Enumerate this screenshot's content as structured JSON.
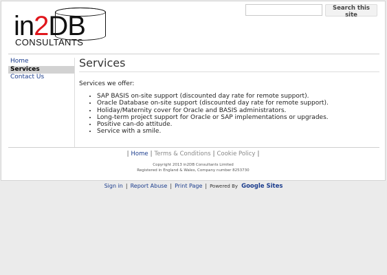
{
  "header": {
    "logo": {
      "main_prefix": "in",
      "main_accent": "2",
      "main_suffix": "DB",
      "sub": "CONSULTANTS"
    },
    "search": {
      "placeholder": "",
      "button_label": "Search this site"
    }
  },
  "sidebar": {
    "items": [
      {
        "label": "Home",
        "active": false
      },
      {
        "label": "Services",
        "active": true
      },
      {
        "label": "Contact Us",
        "active": false
      }
    ]
  },
  "main": {
    "title": "Services",
    "intro": "Services we offer:",
    "services": [
      "SAP BASIS on-site support (discounted day rate for remote support).",
      "Oracle Database on-site support (discounted day rate for remote support).",
      "Holiday/Maternity cover for Oracle and BASIS administrators.",
      "Long-term project support for Oracle or SAP implementations or upgrades.",
      "Positive can-do attitude.",
      "Service with a smile."
    ]
  },
  "footer": {
    "links": [
      "Home",
      "Terms & Conditions",
      "Cookie Policy"
    ],
    "copyright_line1": "Copyright 2013 in2DB Consultants Limited",
    "copyright_line2": "Registered in England & Wales, Company number 8253730"
  },
  "bottom_bar": {
    "sign_in": "Sign in",
    "report_abuse": "Report Abuse",
    "print_page": "Print Page",
    "powered_by": "Powered By",
    "google_sites": "Google Sites"
  },
  "colors": {
    "link": "#1a3c8d",
    "logo_accent": "#e0161c",
    "active_nav_bg": "#d2d2d2",
    "page_bg": "#ebebeb"
  }
}
